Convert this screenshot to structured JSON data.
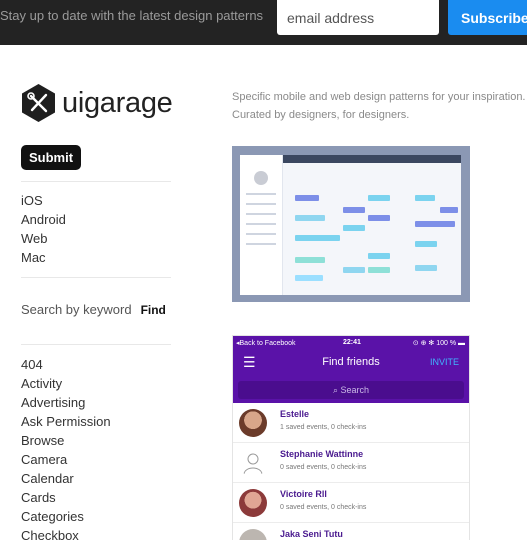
{
  "newsletter": {
    "tagline": "Stay up to date with the latest design patterns",
    "email_placeholder": "email address",
    "subscribe_label": "Subscribe"
  },
  "brand": {
    "name": "uigarage",
    "logo_icon": "wrench-screwdriver-icon"
  },
  "sidebar": {
    "submit_label": "Submit",
    "platforms": [
      "iOS",
      "Android",
      "Web",
      "Mac"
    ],
    "search_label": "Search by keyword",
    "find_label": "Find",
    "categories": [
      "404",
      "Activity",
      "Advertising",
      "Ask Permission",
      "Browse",
      "Camera",
      "Calendar",
      "Cards",
      "Categories",
      "Checkbox"
    ]
  },
  "intro": {
    "line1": "Specific mobile and web design patterns for your inspiration.",
    "line2": "Curated by designers, for designers."
  },
  "pattern_shot_2": {
    "status_back": "◂Back to Facebook",
    "status_time": "22:41",
    "status_battery": "⊙ ⊕ ✻ 100 % ▬",
    "menu_icon": "hamburger-icon",
    "title": "Find friends",
    "invite_label": "INVITE",
    "search_placeholder": "Search",
    "friends": [
      {
        "name": "Estelle",
        "sub": "1 saved events, 0 check-ins"
      },
      {
        "name": "Stephanie Wattinne",
        "sub": "0 saved events, 0 check-ins"
      },
      {
        "name": "Victoire Rll",
        "sub": "0 saved events, 0 check-ins"
      },
      {
        "name": "Jaka Seni Tutu",
        "sub": ""
      }
    ]
  },
  "colors": {
    "topbar": "#232323",
    "subscribe": "#1a8cf0",
    "app_purple": "#5a12a8",
    "invite": "#3fb6ff"
  }
}
